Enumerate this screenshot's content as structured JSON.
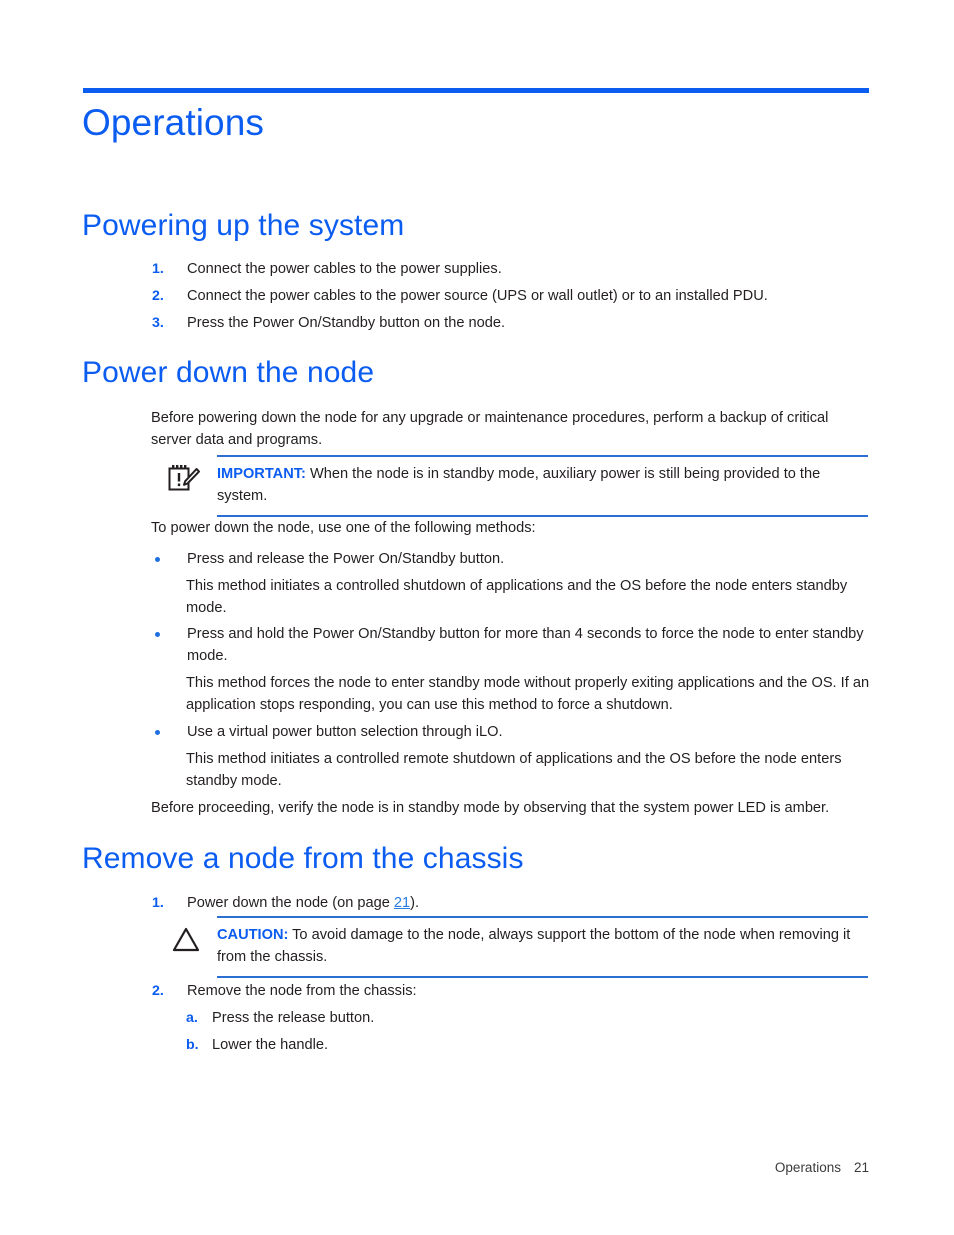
{
  "document": {
    "chapter_title": "Operations",
    "footer": {
      "section": "Operations",
      "page_number": "21"
    }
  },
  "sections": [
    {
      "heading": "Powering up the system",
      "steps": [
        {
          "marker": "1.",
          "text": "Connect the power cables to the power supplies."
        },
        {
          "marker": "2.",
          "text": "Connect the power cables to the power source (UPS or wall outlet) or to an installed PDU."
        },
        {
          "marker": "3.",
          "text": "Press the Power On/Standby button on the node."
        }
      ]
    },
    {
      "heading": "Power down the node",
      "intro": "Before powering down the node for any upgrade or maintenance procedures, perform a backup of critical server data and programs.",
      "important_note": {
        "icon": "note-pencil-icon",
        "label": "IMPORTANT:",
        "text": "When the node is in standby mode, auxiliary power is still being provided to the system."
      },
      "lead_in": "To power down the node, use one of the following methods:",
      "methods": [
        {
          "bullet": "Press and release the Power On/Standby button.",
          "detail": "This method initiates a controlled shutdown of applications and the OS before the node enters standby mode."
        },
        {
          "bullet": "Press and hold the Power On/Standby button for more than 4 seconds to force the node to enter standby mode.",
          "detail": "This method forces the node to enter standby mode without properly exiting applications and the OS. If an application stops responding, you can use this method to force a shutdown."
        },
        {
          "bullet": "Use a virtual power button selection through iLO.",
          "detail": "This method initiates a controlled remote shutdown of applications and the OS before the node enters standby mode."
        }
      ],
      "closing": "Before proceeding, verify the node is in standby mode by observing that the system power LED is amber."
    },
    {
      "heading": "Remove a node from the chassis",
      "steps": [
        {
          "marker": "1.",
          "text_before_link": "Power down the node (on page ",
          "link_text": "21",
          "text_after_link": ")."
        },
        {
          "marker": "2.",
          "text": "Remove the node from the chassis:"
        }
      ],
      "caution_note": {
        "icon": "warning-triangle-icon",
        "label": "CAUTION:",
        "text": "To avoid damage to the node, always support the bottom of the node when removing it from the chassis."
      },
      "substeps": [
        {
          "marker": "a.",
          "text": "Press the release button."
        },
        {
          "marker": "b.",
          "text": "Lower the handle."
        }
      ]
    }
  ],
  "colors": {
    "accent_blue": "#0b5cf0",
    "rule_blue": "#2a6fd1",
    "body_text": "#231f20",
    "link_blue": "#2a7de1"
  }
}
